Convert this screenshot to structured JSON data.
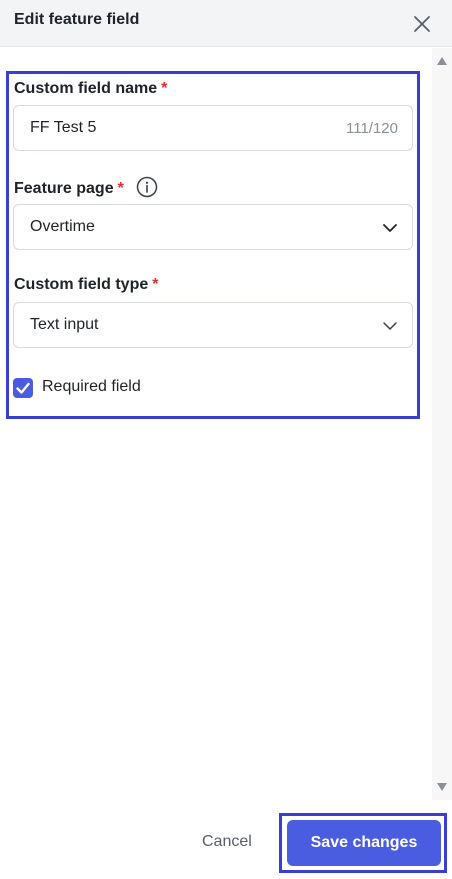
{
  "header": {
    "title": "Edit feature field"
  },
  "form": {
    "custom_field_name": {
      "label": "Custom field name",
      "required_mark": "*",
      "value": "FF Test 5",
      "counter": "111/120"
    },
    "feature_page": {
      "label": "Feature page",
      "required_mark": "*",
      "selected": "Overtime"
    },
    "custom_field_type": {
      "label": "Custom field type",
      "required_mark": "*",
      "selected": "Text input"
    },
    "required_field": {
      "label": "Required field",
      "checked": true
    }
  },
  "footer": {
    "cancel_label": "Cancel",
    "save_label": "Save changes"
  },
  "colors": {
    "accent": "#4a5ce0",
    "required": "#e03030",
    "highlight": "#3b3fd1"
  }
}
